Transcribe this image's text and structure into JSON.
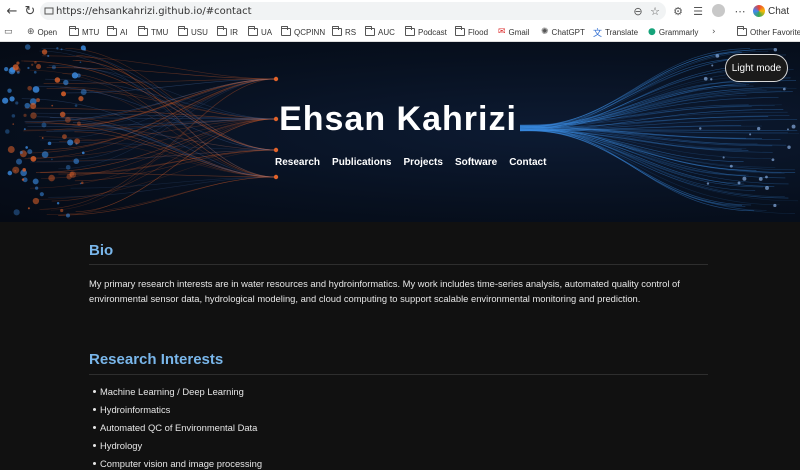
{
  "browser": {
    "url": "https://ehsankahrizi.github.io/#contact",
    "chat_label": "Chat"
  },
  "bookmarks": [
    {
      "label": "Open",
      "icon": "globe-icon"
    },
    {
      "label": "MTU",
      "icon": "folder-icon"
    },
    {
      "label": "AI",
      "icon": "folder-icon"
    },
    {
      "label": "TMU",
      "icon": "folder-icon"
    },
    {
      "label": "USU",
      "icon": "folder-icon"
    },
    {
      "label": "IR",
      "icon": "folder-icon"
    },
    {
      "label": "UA",
      "icon": "folder-icon"
    },
    {
      "label": "QCPINN",
      "icon": "folder-icon"
    },
    {
      "label": "RS",
      "icon": "folder-icon"
    },
    {
      "label": "AUC",
      "icon": "folder-icon"
    },
    {
      "label": "Podcast",
      "icon": "folder-icon"
    },
    {
      "label": "Flood",
      "icon": "folder-icon"
    },
    {
      "label": "Gmail",
      "icon": "gmail-icon"
    },
    {
      "label": "ChatGPT",
      "icon": "chatgpt-icon"
    },
    {
      "label": "Translate",
      "icon": "translate-icon"
    },
    {
      "label": "Grammarly",
      "icon": "grammarly-icon"
    }
  ],
  "other_favorites": "Other Favorites",
  "hero": {
    "title": "Ehsan Kahrizi",
    "theme_toggle": "Light mode",
    "nav": [
      "Research",
      "Publications",
      "Projects",
      "Software",
      "Contact"
    ]
  },
  "bio": {
    "heading": "Bio",
    "text": "My primary research interests are in water resources and hydroinformatics. My work includes time-series analysis, automated quality control of environmental sensor data, hydrological modeling, and cloud computing to support scalable environmental monitoring and prediction."
  },
  "research_interests": {
    "heading": "Research Interests",
    "items": [
      "Machine Learning / Deep Learning",
      "Hydroinformatics",
      "Automated QC of Environmental Data",
      "Hydrology",
      "Computer vision and image processing"
    ]
  },
  "colors": {
    "accent_heading": "#79b6ea",
    "hero_orange": "#e0622a",
    "hero_blue": "#3b8be0",
    "page_bg": "#111111"
  }
}
